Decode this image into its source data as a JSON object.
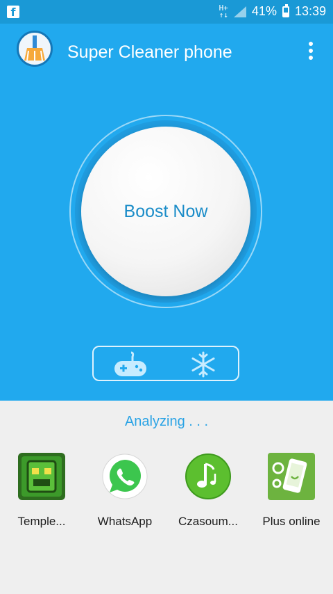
{
  "status_bar": {
    "left_icon": "facebook-notification-icon",
    "network_icon": "data-transfer-icon",
    "signal_icon": "signal-icon",
    "battery_percent": "41%",
    "battery_level": 0.41,
    "time": "13:39"
  },
  "app_bar": {
    "title": "Super Cleaner phone",
    "logo_icon": "broom-icon",
    "menu_icon": "more-vert-icon"
  },
  "hero": {
    "boost_label": "Boost Now",
    "modes": [
      {
        "name": "game-mode",
        "icon": "gamepad-icon"
      },
      {
        "name": "cool-mode",
        "icon": "snowflake-icon"
      }
    ]
  },
  "bottom": {
    "status": "Analyzing . . .",
    "apps": [
      {
        "label": "Temple...",
        "icon": "temple-run-icon"
      },
      {
        "label": "WhatsApp",
        "icon": "whatsapp-icon"
      },
      {
        "label": "Czasoum...",
        "icon": "music-note-icon"
      },
      {
        "label": "Plus online",
        "icon": "plus-online-icon"
      }
    ]
  },
  "colors": {
    "accent": "#21a9ee",
    "status_bar": "#1a99d6",
    "boost_text": "#1a8cc8",
    "analyzing_text": "#2aa3e5"
  }
}
